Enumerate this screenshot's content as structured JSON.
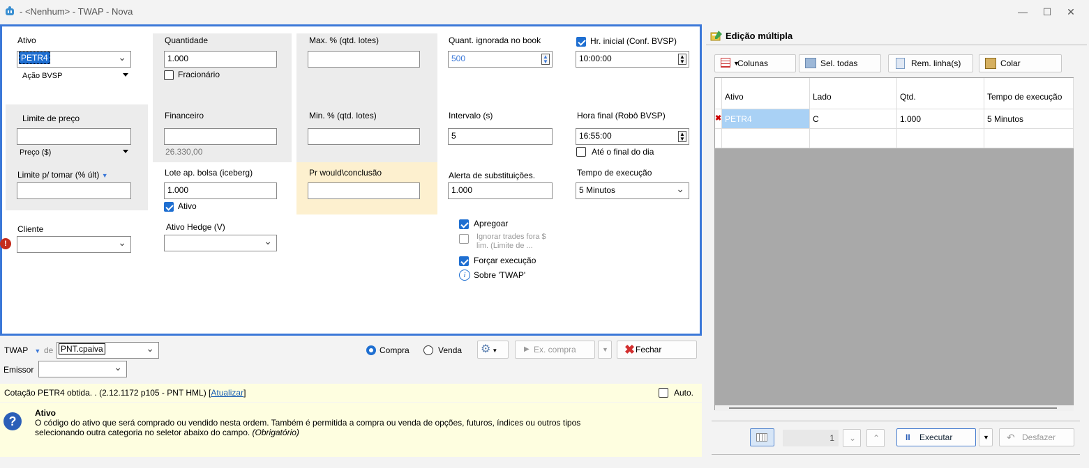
{
  "window": {
    "title": "- <Nenhum> - TWAP - Nova",
    "minimize": "—",
    "maximize": "☐",
    "close": "✕"
  },
  "form": {
    "ativo": {
      "label": "Ativo",
      "value": "PETR4",
      "category": "Ação BVSP"
    },
    "limite_preco": {
      "label": "Limite de preço",
      "value": "",
      "unit": "Preço ($)"
    },
    "limite_tomar": {
      "label": "Limite p/ tomar (% últ)",
      "value": ""
    },
    "cliente": {
      "label": "Cliente",
      "value": ""
    },
    "quantidade": {
      "label": "Quantidade",
      "value": "1.000",
      "fracionario": "Fracionário"
    },
    "financeiro": {
      "label": "Financeiro",
      "value": "",
      "sub": "26.330,00"
    },
    "lote": {
      "label": "Lote ap. bolsa (iceberg)",
      "value": "1.000",
      "ativo": "Ativo"
    },
    "hedge": {
      "label": "Ativo Hedge (V)",
      "value": ""
    },
    "max_pct": {
      "label": "Max. % (qtd. lotes)",
      "value": ""
    },
    "min_pct": {
      "label": "Min. % (qtd. lotes)",
      "value": ""
    },
    "pr_would": {
      "label": "Pr would\\conclusão",
      "value": ""
    },
    "quant_ignorada": {
      "label": "Quant. ignorada no book",
      "value": "500"
    },
    "intervalo": {
      "label": "Intervalo (s)",
      "value": "5"
    },
    "alerta": {
      "label": "Alerta de substituições.",
      "value": "1.000"
    },
    "hr_inicial": {
      "label": "Hr. inicial (Conf. BVSP)",
      "value": "10:00:00"
    },
    "hora_final": {
      "label": "Hora final (Robô BVSP)",
      "value": "16:55:00",
      "ate_final": "Até o final do dia"
    },
    "tempo": {
      "label": "Tempo de execução",
      "value": "5 Minutos"
    },
    "apregoar": "Apregoar",
    "ignorar": "Ignorar trades fora $ lim. (Limite de ...",
    "forcar": "Forçar execução",
    "sobre": "Sobre 'TWAP'"
  },
  "bottom": {
    "strategy": "TWAP",
    "de": "de",
    "account": "PNT.cpaiva",
    "compra": "Compra",
    "venda": "Venda",
    "ex_compra": "Ex. compra",
    "fechar": "Fechar",
    "emissor_label": "Emissor",
    "emissor_value": "",
    "status": "Cotação PETR4 obtida. .  (2.12.1172 p105 - PNT HML) [",
    "atualizar": "Atualizar",
    "status_end": "]",
    "auto": "Auto."
  },
  "help": {
    "title": "Ativo",
    "text1": "O código do ativo que será comprado ou vendido nesta ordem. Também é permitida a compra ou venda de opções, futuros, índices ou outros tipos",
    "text2": "selecionando outra categoria no seletor abaixo do campo. ",
    "obrig": "(Obrigatório)"
  },
  "edicao": {
    "title": "Edição múltipla",
    "buttons": {
      "colunas": "Colunas",
      "sel_todas": "Sel. todas",
      "rem_linha": "Rem. linha(s)",
      "colar": "Colar"
    },
    "columns": [
      "Ativo",
      "Lado",
      "Qtd.",
      "Tempo de execução"
    ],
    "row": [
      "PETR4",
      "C",
      "1.000",
      "5 Minutos"
    ],
    "page": "1",
    "executar": "Executar",
    "desfazer": "Desfazer"
  },
  "colors": {
    "accent": "#3b78d8",
    "check": "#1f6fd1",
    "grey_panel": "#ececec",
    "yellow_panel": "#fdf0cf",
    "help_bg": "#fefee0",
    "grid_bg": "#a9a9a9",
    "selected_cell": "#a9d1f5"
  }
}
